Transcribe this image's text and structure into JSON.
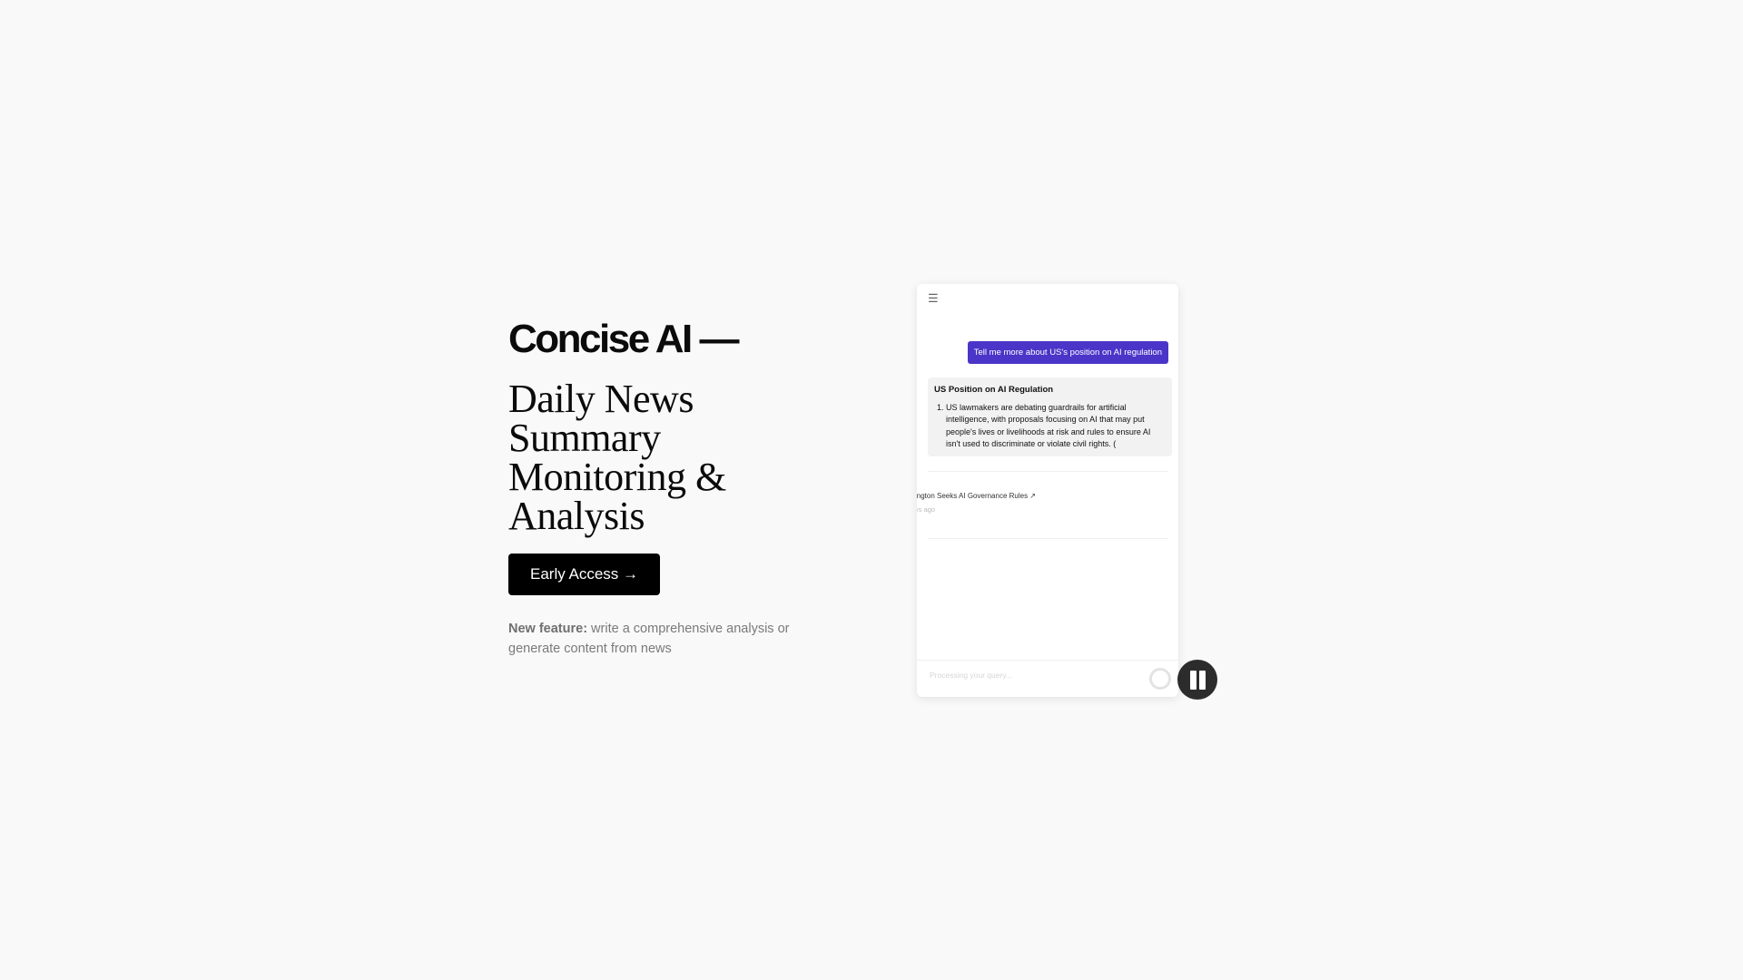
{
  "hero": {
    "brand": "Concise AI —",
    "headline_lines": [
      "Daily News",
      "Summary",
      "Monitoring &",
      "Analysis"
    ],
    "cta_label": "Early Access →",
    "feature_label": "New feature:",
    "feature_text": " write a comprehensive analysis or generate content from news"
  },
  "chat": {
    "menu_icon": "hamburger-icon",
    "user_message": "Tell me more about US's position on AI regulation",
    "answer_title": "US Position on AI Regulation",
    "answer_items": [
      "US lawmakers are debating guardrails for artificial intelligence, with proposals focusing on AI that may put people's lives or livelihoods at risk and rules to ensure AI isn't used to discriminate or violate civil rights. ("
    ],
    "news_title": "ington Seeks AI Governance Rules ↗",
    "news_time": "ys ago",
    "input_placeholder": "Processing your query..."
  },
  "controls": {
    "pause_icon": "pause-icon"
  }
}
